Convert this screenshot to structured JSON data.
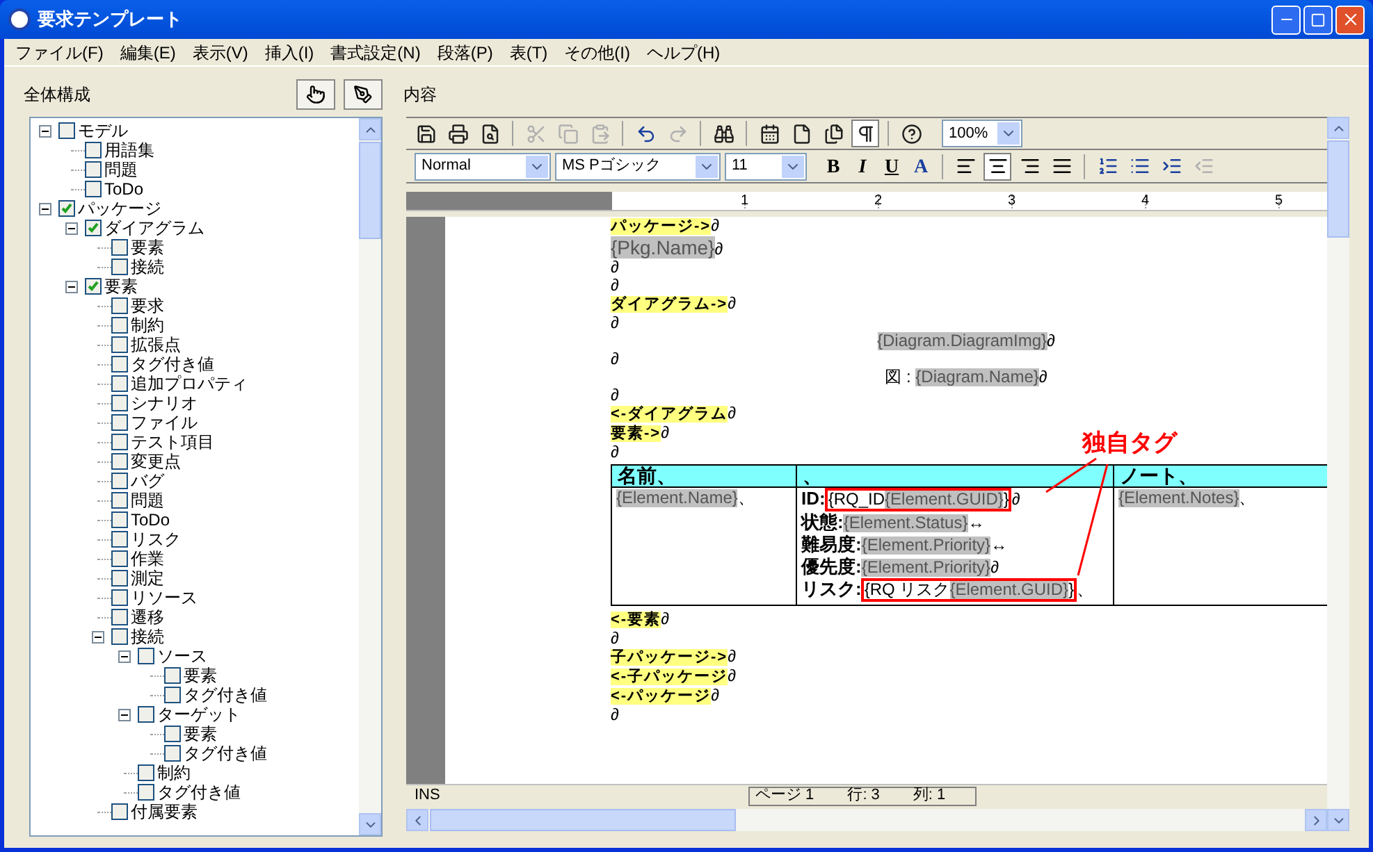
{
  "window": {
    "title": "要求テンプレート"
  },
  "menu": [
    "ファイル(F)",
    "編集(E)",
    "表示(V)",
    "挿入(I)",
    "書式設定(N)",
    "段落(P)",
    "表(T)",
    "その他(I)",
    "ヘルプ(H)"
  ],
  "left_panel": {
    "title": "全体構成"
  },
  "tree": {
    "items": [
      {
        "label": "モデル",
        "checked": false,
        "expanded": true,
        "children": [
          {
            "label": "用語集",
            "checked": false
          },
          {
            "label": "問題",
            "checked": false
          },
          {
            "label": "ToDo",
            "checked": false
          }
        ]
      },
      {
        "label": "パッケージ",
        "checked": true,
        "expanded": true,
        "children": [
          {
            "label": "ダイアグラム",
            "checked": true,
            "expanded": true,
            "children": [
              {
                "label": "要素",
                "checked": false
              },
              {
                "label": "接続",
                "checked": false
              }
            ]
          },
          {
            "label": "要素",
            "checked": true,
            "expanded": true,
            "children": [
              {
                "label": "要求",
                "checked": false
              },
              {
                "label": "制約",
                "checked": false
              },
              {
                "label": "拡張点",
                "checked": false
              },
              {
                "label": "タグ付き値",
                "checked": false
              },
              {
                "label": "追加プロパティ",
                "checked": false
              },
              {
                "label": "シナリオ",
                "checked": false
              },
              {
                "label": "ファイル",
                "checked": false
              },
              {
                "label": "テスト項目",
                "checked": false
              },
              {
                "label": "変更点",
                "checked": false
              },
              {
                "label": "バグ",
                "checked": false
              },
              {
                "label": "問題",
                "checked": false
              },
              {
                "label": "ToDo",
                "checked": false
              },
              {
                "label": "リスク",
                "checked": false
              },
              {
                "label": "作業",
                "checked": false
              },
              {
                "label": "測定",
                "checked": false
              },
              {
                "label": "リソース",
                "checked": false
              },
              {
                "label": "遷移",
                "checked": false
              },
              {
                "label": "接続",
                "checked": false,
                "expanded": true,
                "children": [
                  {
                    "label": "ソース",
                    "checked": false,
                    "expanded": true,
                    "children": [
                      {
                        "label": "要素",
                        "checked": false
                      },
                      {
                        "label": "タグ付き値",
                        "checked": false
                      }
                    ]
                  },
                  {
                    "label": "ターゲット",
                    "checked": false,
                    "expanded": true,
                    "children": [
                      {
                        "label": "要素",
                        "checked": false
                      },
                      {
                        "label": "タグ付き値",
                        "checked": false
                      }
                    ]
                  },
                  {
                    "label": "制約",
                    "checked": false
                  },
                  {
                    "label": "タグ付き値",
                    "checked": false
                  }
                ]
              },
              {
                "label": "付属要素",
                "checked": false
              }
            ]
          }
        ]
      }
    ]
  },
  "right_panel": {
    "title": "内容"
  },
  "toolbar": [
    {
      "kind": "save",
      "disabled": false
    },
    {
      "kind": "print",
      "disabled": false
    },
    {
      "kind": "preview",
      "disabled": false
    },
    {
      "kind": "sep"
    },
    {
      "kind": "cut",
      "disabled": true
    },
    {
      "kind": "copy",
      "disabled": true
    },
    {
      "kind": "paste",
      "disabled": true
    },
    {
      "kind": "sep"
    },
    {
      "kind": "undo",
      "disabled": false
    },
    {
      "kind": "redo",
      "disabled": true
    },
    {
      "kind": "sep"
    },
    {
      "kind": "find",
      "disabled": false
    },
    {
      "kind": "sep"
    },
    {
      "kind": "date",
      "disabled": false
    },
    {
      "kind": "page",
      "disabled": false
    },
    {
      "kind": "pages",
      "disabled": false
    },
    {
      "kind": "pilcrow",
      "disabled": false,
      "selected": true
    },
    {
      "kind": "sep"
    },
    {
      "kind": "help",
      "disabled": false
    }
  ],
  "zoom": {
    "value": "100%"
  },
  "format_bar": {
    "style": "Normal",
    "font": "MS Pゴシック",
    "size": "11",
    "text_buttons": [
      {
        "kind": "bold",
        "label": "B"
      },
      {
        "kind": "italic",
        "label": "I"
      },
      {
        "kind": "underline",
        "label": "U"
      },
      {
        "kind": "color",
        "label": "A"
      }
    ],
    "align": [
      {
        "kind": "left",
        "selected": false
      },
      {
        "kind": "center",
        "selected": true
      },
      {
        "kind": "right",
        "selected": false
      },
      {
        "kind": "justify",
        "selected": false
      }
    ],
    "lists": [
      {
        "kind": "numbered",
        "disabled": false
      },
      {
        "kind": "bullets",
        "disabled": false
      },
      {
        "kind": "indent",
        "disabled": false
      },
      {
        "kind": "outdent",
        "disabled": true
      }
    ]
  },
  "ruler": [
    "1",
    "2",
    "3",
    "4",
    "5"
  ],
  "document": {
    "lines_before": [
      {
        "kind": "plain",
        "segments": [
          {
            "kind": "tag",
            "text": "パッケージ->"
          },
          {
            "kind": "text",
            "text": "∂"
          }
        ]
      },
      {
        "kind": "plain",
        "segments": [
          {
            "kind": "bigfield",
            "text": "{Pkg.Name}"
          },
          {
            "kind": "text",
            "text": "∂"
          }
        ]
      },
      {
        "kind": "plain",
        "segments": [
          {
            "kind": "text",
            "text": "∂"
          }
        ]
      },
      {
        "kind": "plain",
        "segments": [
          {
            "kind": "text",
            "text": "∂"
          }
        ]
      },
      {
        "kind": "plain",
        "segments": [
          {
            "kind": "tag",
            "text": "ダイアグラム->"
          },
          {
            "kind": "text",
            "text": "∂"
          }
        ]
      },
      {
        "kind": "plain",
        "segments": [
          {
            "kind": "text",
            "text": "∂"
          }
        ]
      },
      {
        "kind": "centered",
        "segments": [
          {
            "kind": "field",
            "text": "{Diagram.DiagramImg}"
          },
          {
            "kind": "text",
            "text": "∂"
          }
        ]
      },
      {
        "kind": "plain",
        "segments": [
          {
            "kind": "text",
            "text": "∂"
          }
        ]
      },
      {
        "kind": "centered",
        "segments": [
          {
            "kind": "text",
            "text": "図 : "
          },
          {
            "kind": "field",
            "text": "{Diagram.Name}"
          },
          {
            "kind": "text",
            "text": "∂"
          }
        ]
      },
      {
        "kind": "plain",
        "segments": [
          {
            "kind": "text",
            "text": "∂"
          }
        ]
      },
      {
        "kind": "plain",
        "segments": [
          {
            "kind": "tag",
            "text": "<-ダイアグラム"
          },
          {
            "kind": "text",
            "text": "∂"
          }
        ]
      },
      {
        "kind": "plain",
        "segments": [
          {
            "kind": "tag",
            "text": "要素->"
          },
          {
            "kind": "text",
            "text": "∂"
          }
        ]
      },
      {
        "kind": "plain",
        "segments": [
          {
            "kind": "text",
            "text": "∂"
          }
        ]
      }
    ],
    "table": {
      "header": [
        "名前、",
        "、",
        "ノート、"
      ],
      "cells": [
        [
          [
            {
              "kind": "field",
              "text": "{Element.Name}"
            },
            {
              "kind": "text",
              "text": "、"
            }
          ]
        ],
        [
          [
            {
              "kind": "bold",
              "text": "ID:"
            },
            {
              "kind": "boxed",
              "parts": [
                {
                  "kind": "text",
                  "text": "{RQ_ID"
                },
                {
                  "kind": "field",
                  "text": "{Element.GUID}"
                },
                {
                  "kind": "text",
                  "text": "}"
                }
              ]
            },
            {
              "kind": "text",
              "text": "∂"
            }
          ],
          [
            {
              "kind": "bold",
              "text": "状態:"
            },
            {
              "kind": "field",
              "text": "{Element.Status}"
            },
            {
              "kind": "text",
              "text": "↔"
            }
          ],
          [
            {
              "kind": "bold",
              "text": "難易度:"
            },
            {
              "kind": "field",
              "text": "{Element.Priority}"
            },
            {
              "kind": "text",
              "text": "↔"
            }
          ],
          [
            {
              "kind": "bold",
              "text": "優先度:"
            },
            {
              "kind": "field",
              "text": "{Element.Priority}"
            },
            {
              "kind": "text",
              "text": "∂"
            }
          ],
          [
            {
              "kind": "bold",
              "text": "リスク:"
            },
            {
              "kind": "boxed",
              "parts": [
                {
                  "kind": "text",
                  "text": "{RQ リスク"
                },
                {
                  "kind": "field",
                  "text": "{Element.GUID}"
                },
                {
                  "kind": "text",
                  "text": "}"
                }
              ]
            },
            {
              "kind": "text",
              "text": "、"
            }
          ]
        ],
        [
          [
            {
              "kind": "field",
              "text": "{Element.Notes}"
            },
            {
              "kind": "text",
              "text": "、"
            }
          ]
        ]
      ]
    },
    "lines_after": [
      {
        "kind": "plain",
        "segments": [
          {
            "kind": "tag",
            "text": "<-要素"
          },
          {
            "kind": "text",
            "text": "∂"
          }
        ]
      },
      {
        "kind": "plain",
        "segments": [
          {
            "kind": "text",
            "text": "∂"
          }
        ]
      },
      {
        "kind": "plain",
        "segments": [
          {
            "kind": "tag",
            "text": "子パッケージ->"
          },
          {
            "kind": "text",
            "text": "∂"
          }
        ]
      },
      {
        "kind": "plain",
        "segments": [
          {
            "kind": "tag",
            "text": "<-子パッケージ"
          },
          {
            "kind": "text",
            "text": "∂"
          }
        ]
      },
      {
        "kind": "plain",
        "segments": [
          {
            "kind": "tag",
            "text": "<-パッケージ"
          },
          {
            "kind": "text",
            "text": "∂"
          }
        ]
      },
      {
        "kind": "plain",
        "segments": [
          {
            "kind": "text",
            "text": "∂"
          }
        ]
      }
    ],
    "annotation": "独自タグ"
  },
  "status_bar": {
    "mode": "INS",
    "page": "ページ 1",
    "row": "行: 3",
    "column": "列: 1"
  }
}
